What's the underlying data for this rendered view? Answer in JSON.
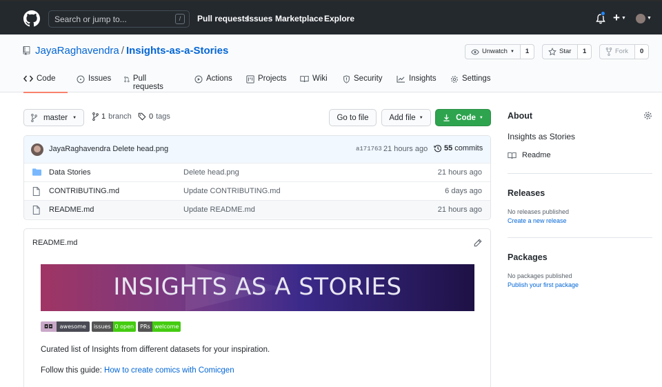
{
  "header": {
    "search_placeholder": "Search or jump to...",
    "search_shortcut": "/",
    "nav": [
      "Pull requests",
      "Issues",
      "Marketplace",
      "Explore"
    ],
    "plus_label": "+"
  },
  "repo": {
    "owner": "JayaRaghavendra",
    "separator": "/",
    "name": "Insights-as-a-Stories",
    "watch": {
      "label": "Unwatch",
      "count": "1"
    },
    "star": {
      "label": "Star",
      "count": "1"
    },
    "fork": {
      "label": "Fork",
      "count": "0"
    }
  },
  "tabs": [
    "Code",
    "Issues",
    "Pull requests",
    "Actions",
    "Projects",
    "Wiki",
    "Security",
    "Insights",
    "Settings"
  ],
  "toolbar": {
    "branch": "master",
    "branches_count": "1",
    "branches_label": "branch",
    "tags_count": "0",
    "tags_label": "tags",
    "go_to_file": "Go to file",
    "add_file": "Add file",
    "code": "Code"
  },
  "commit": {
    "message": "JayaRaghavendra Delete head.png",
    "sha": "a171763",
    "ago": "21 hours ago",
    "count": "55",
    "count_label": "commits"
  },
  "files": [
    {
      "name": "Data Stories",
      "type": "folder",
      "message": "Delete head.png",
      "age": "21 hours ago"
    },
    {
      "name": "CONTRIBUTING.md",
      "type": "file",
      "message": "Update CONTRIBUTING.md",
      "age": "6 days ago"
    },
    {
      "name": "README.md",
      "type": "file",
      "message": "Update README.md",
      "age": "21 hours ago"
    }
  ],
  "readme": {
    "title": "README.md",
    "banner": "INSIGHTS AS A STORIES",
    "badges": {
      "awesome": "awesome",
      "issues_left": "issues",
      "issues_right": "0 open",
      "prs_left": "PRs",
      "prs_right": "welcome"
    },
    "intro": "Curated list of Insights from different datasets for your inspiration.",
    "guide_prefix": "Follow this guide: ",
    "guide_link": "How to create comics with Comicgen"
  },
  "sidebar": {
    "about_title": "About",
    "about_text": "Insights as Stories",
    "readme_link": "Readme",
    "releases_title": "Releases",
    "releases_empty": "No releases published",
    "releases_link": "Create a new release",
    "packages_title": "Packages",
    "packages_empty": "No packages published",
    "packages_link": "Publish your first package"
  },
  "colors": {
    "header_bg": "#24292e",
    "link": "#0366d6",
    "green_button": "#2ea44f",
    "selected_tab_underline": "#f9826c",
    "badge_green": "#4c1",
    "badge_dark": "#555555"
  }
}
